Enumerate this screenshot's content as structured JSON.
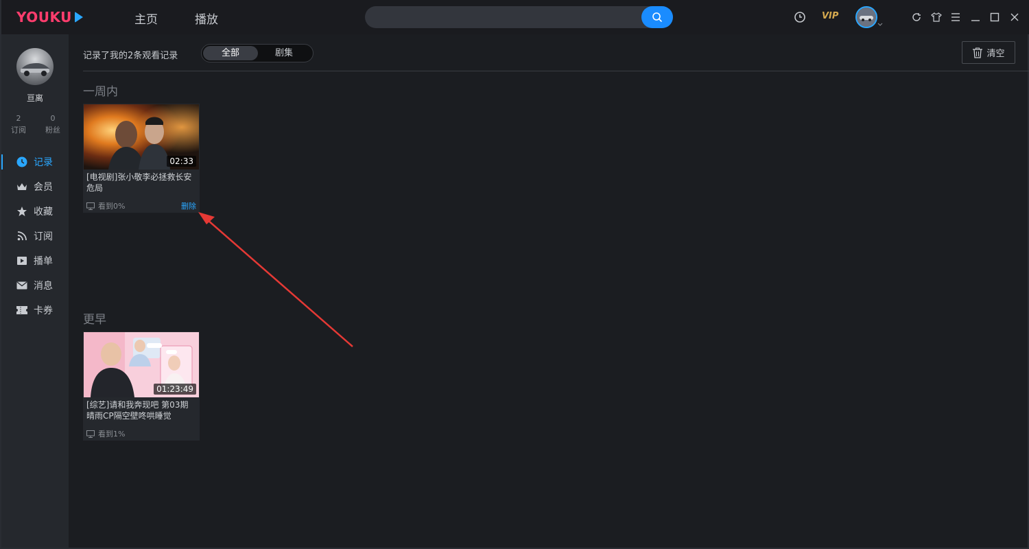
{
  "app": {
    "logo": "YOUKU",
    "nav": {
      "home": "主页",
      "play": "播放"
    },
    "search": {
      "placeholder": ""
    },
    "vip_label": "VIP",
    "accent": "#2aa7ff",
    "logo_color": "#ff3d6d"
  },
  "sidebar": {
    "username": "亘离",
    "stats": [
      {
        "value": "2",
        "label": "订阅"
      },
      {
        "value": "0",
        "label": "粉丝"
      }
    ],
    "items": [
      {
        "label": "记录",
        "icon": "clock-icon",
        "active": true
      },
      {
        "label": "会员",
        "icon": "crown-icon"
      },
      {
        "label": "收藏",
        "icon": "star-icon"
      },
      {
        "label": "订阅",
        "icon": "rss-icon"
      },
      {
        "label": "播单",
        "icon": "playlist-icon"
      },
      {
        "label": "消息",
        "icon": "mail-icon"
      },
      {
        "label": "卡券",
        "icon": "ticket-icon"
      }
    ]
  },
  "main": {
    "summary": "记录了我的2条观看记录",
    "filter": {
      "all": "全部",
      "series": "剧集",
      "selected": "全部"
    },
    "clear_label": "清空",
    "sections": [
      {
        "title": "一周内",
        "items": [
          {
            "title": "[电视剧]张小敬李必拯救长安危局",
            "duration": "02:33",
            "progress": "看到0%",
            "delete_label": "删除"
          }
        ]
      },
      {
        "title": "更早",
        "items": [
          {
            "title": "[综艺]请和我奔现吧 第03期 晴雨CP隔空壁咚哄睡觉",
            "duration": "01:23:49",
            "progress": "看到1%"
          }
        ]
      }
    ]
  }
}
